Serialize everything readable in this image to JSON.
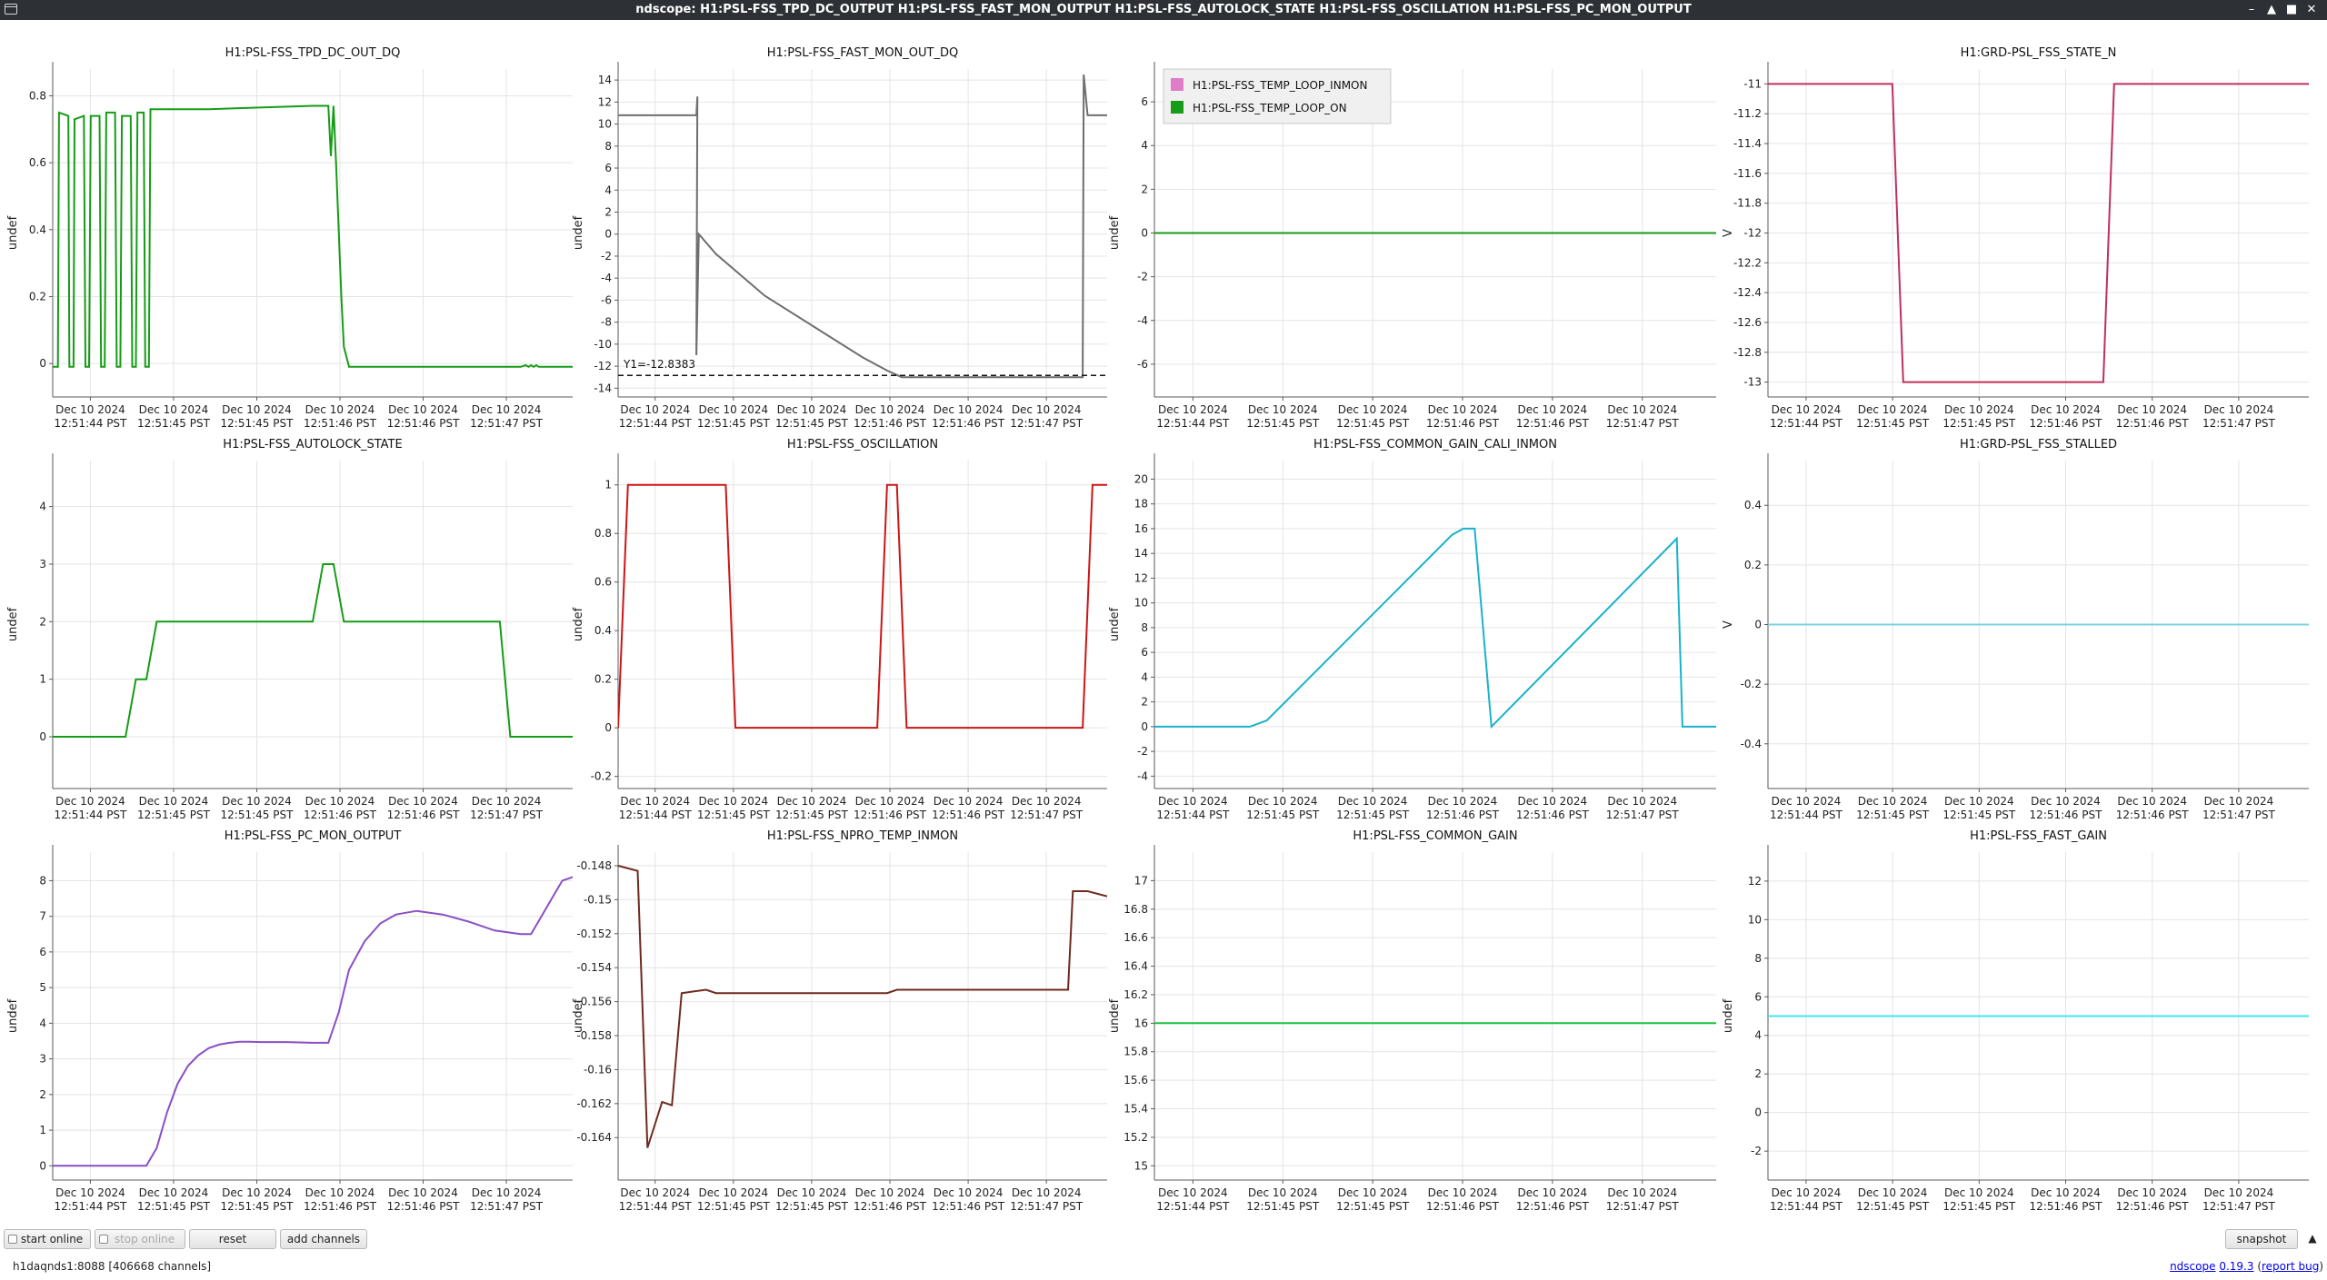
{
  "window": {
    "title": "ndscope: H1:PSL-FSS_TPD_DC_OUTPUT H1:PSL-FSS_FAST_MON_OUTPUT H1:PSL-FSS_AUTOLOCK_STATE H1:PSL-FSS_OSCILLATION H1:PSL-FSS_PC_MON_OUTPUT",
    "controls": {
      "minimize": "–",
      "restore": "▲",
      "maximize": "■",
      "close": "✕"
    }
  },
  "toolbar": {
    "start_online": "start online",
    "stop_online": "stop online",
    "reset": "reset",
    "add_channels": "add channels",
    "snapshot": "snapshot",
    "collapse": "▲"
  },
  "status": {
    "server": "h1daqnds1:8088",
    "channels": "[406668 channels]"
  },
  "version": {
    "app_link": "ndscope",
    "version_link": "0.19.3",
    "open_paren": " (",
    "bug_link": "report bug",
    "close_paren": ")"
  },
  "colors": {
    "background": "#ffffff",
    "grid": "#e4e4e4",
    "axis": "#5a5a5a",
    "titlebar": "#2d3136",
    "green": "#169c16",
    "gray": "#6e6e6e",
    "crimson": "#c0305c",
    "red": "#cc1616",
    "cyan": "#19b2cc",
    "light_cyan": "#7fd0dc",
    "purple": "#8a4fc4",
    "brown": "#6e2a1e",
    "bright_green": "#1bc43b",
    "aqua": "#3fe8e8",
    "pink": "#e07cc8"
  },
  "time_ticks": [
    {
      "date": "Dec 10 2024",
      "time": "12:51:44 PST"
    },
    {
      "date": "Dec 10 2024",
      "time": "12:51:45 PST"
    },
    {
      "date": "Dec 10 2024",
      "time": "12:51:45 PST"
    },
    {
      "date": "Dec 10 2024",
      "time": "12:51:46 PST"
    },
    {
      "date": "Dec 10 2024",
      "time": "12:51:46 PST"
    },
    {
      "date": "Dec 10 2024",
      "time": "12:51:47 PST"
    }
  ],
  "chart_data": [
    {
      "type": "line",
      "title": "H1:PSL-FSS_TPD_DC_OUT_DQ",
      "ylabel": "undef",
      "ylim": [
        -0.1,
        0.88
      ],
      "yticks": [
        0,
        0.2,
        0.4,
        0.6,
        0.8
      ],
      "series": [
        {
          "color": "#169c16",
          "x": [
            0,
            0.01,
            0.012,
            0.03,
            0.032,
            0.04,
            0.042,
            0.06,
            0.063,
            0.07,
            0.073,
            0.09,
            0.093,
            0.1,
            0.103,
            0.12,
            0.123,
            0.13,
            0.133,
            0.15,
            0.153,
            0.16,
            0.163,
            0.175,
            0.178,
            0.185,
            0.188,
            0.3,
            0.5,
            0.52,
            0.53,
            0.535,
            0.54,
            0.545,
            0.55,
            0.555,
            0.56,
            0.57,
            0.58,
            0.6,
            0.62,
            0.8,
            0.9,
            0.91,
            0.915,
            0.92,
            0.925,
            0.93,
            0.935,
            1
          ],
          "y": [
            -0.01,
            -0.01,
            0.75,
            0.74,
            -0.01,
            -0.01,
            0.73,
            0.74,
            -0.01,
            -0.01,
            0.74,
            0.74,
            -0.01,
            -0.01,
            0.75,
            0.75,
            -0.01,
            -0.01,
            0.74,
            0.74,
            -0.01,
            -0.01,
            0.75,
            0.75,
            -0.01,
            -0.01,
            0.76,
            0.76,
            0.77,
            0.77,
            0.77,
            0.62,
            0.77,
            0.6,
            0.4,
            0.2,
            0.05,
            -0.01,
            -0.01,
            -0.01,
            -0.01,
            -0.01,
            -0.01,
            -0.005,
            -0.01,
            -0.005,
            -0.01,
            -0.005,
            -0.01,
            -0.01
          ]
        }
      ]
    },
    {
      "type": "line",
      "title": "H1:PSL-FSS_FAST_MON_OUT_DQ",
      "ylabel": "undef",
      "ylim": [
        -14.8,
        15
      ],
      "yticks": [
        -14,
        -12,
        -10,
        -8,
        -6,
        -4,
        -2,
        0,
        2,
        4,
        6,
        8,
        10,
        12,
        14
      ],
      "cursor": {
        "label": "Y1=-12.8383",
        "y": -12.8383
      },
      "series": [
        {
          "color": "#6e6e6e",
          "x": [
            0,
            0.16,
            0.162,
            0.16,
            0.165,
            0.2,
            0.3,
            0.4,
            0.5,
            0.55,
            0.58,
            0.6,
            0.95,
            0.952,
            0.96,
            1
          ],
          "y": [
            10.8,
            10.8,
            12.5,
            -11,
            0,
            -1.8,
            -5.6,
            -8.4,
            -11.2,
            -12.4,
            -13,
            -13,
            -13,
            14.5,
            10.8,
            10.8
          ]
        }
      ]
    },
    {
      "type": "line",
      "title": "",
      "ylabel": "undef",
      "ylim": [
        -7.5,
        7.5
      ],
      "yticks": [
        -6,
        -4,
        -2,
        0,
        2,
        4,
        6
      ],
      "legend": [
        {
          "label": "H1:PSL-FSS_TEMP_LOOP_INMON",
          "color": "#e07cc8"
        },
        {
          "label": "H1:PSL-FSS_TEMP_LOOP_ON",
          "color": "#169c16"
        }
      ],
      "series": [
        {
          "color": "#169c16",
          "x": [
            0,
            1
          ],
          "y": [
            0,
            0
          ]
        }
      ]
    },
    {
      "type": "line",
      "title": "H1:GRD-PSL_FSS_STATE_N",
      "ylabel": "V",
      "ylim": [
        -13.1,
        -10.9
      ],
      "yticks": [
        -13,
        -12.8,
        -12.6,
        -12.4,
        -12.2,
        -12,
        -11.8,
        -11.6,
        -11.4,
        -11.2,
        -11
      ],
      "series": [
        {
          "color": "#c0305c",
          "x": [
            0,
            0.23,
            0.25,
            0.62,
            0.64,
            1
          ],
          "y": [
            -11,
            -11,
            -13,
            -13,
            -11,
            -11
          ]
        }
      ]
    },
    {
      "type": "line",
      "title": "H1:PSL-FSS_AUTOLOCK_STATE",
      "ylabel": "undef",
      "ylim": [
        -0.9,
        4.8
      ],
      "yticks": [
        0,
        1,
        2,
        3,
        4
      ],
      "series": [
        {
          "color": "#169c16",
          "x": [
            0,
            0.14,
            0.16,
            0.18,
            0.2,
            0.5,
            0.52,
            0.54,
            0.56,
            0.86,
            0.88,
            1
          ],
          "y": [
            0,
            0,
            1,
            1,
            2,
            2,
            3,
            3,
            2,
            2,
            0,
            0
          ]
        }
      ]
    },
    {
      "type": "line",
      "title": "H1:PSL-FSS_OSCILLATION",
      "ylabel": "undef",
      "ylim": [
        -0.25,
        1.1
      ],
      "yticks": [
        -0.2,
        0,
        0.2,
        0.4,
        0.6,
        0.8,
        1
      ],
      "series": [
        {
          "color": "#cc1616",
          "x": [
            0,
            0.02,
            0.22,
            0.24,
            0.53,
            0.55,
            0.57,
            0.59,
            0.95,
            0.97,
            1
          ],
          "y": [
            0,
            1,
            1,
            0,
            0,
            1,
            1,
            0,
            0,
            1,
            1
          ]
        }
      ]
    },
    {
      "type": "line",
      "title": "H1:PSL-FSS_COMMON_GAIN_CALI_INMON",
      "ylabel": "undef",
      "ylim": [
        -5,
        21.5
      ],
      "yticks": [
        -4,
        -2,
        0,
        2,
        4,
        6,
        8,
        10,
        12,
        14,
        16,
        18,
        20
      ],
      "series": [
        {
          "color": "#19b2cc",
          "x": [
            0,
            0.17,
            0.2,
            0.53,
            0.55,
            0.57,
            0.6,
            0.93,
            0.94,
            1
          ],
          "y": [
            0,
            0,
            0.5,
            15.5,
            16,
            16,
            0,
            15.2,
            0,
            0
          ]
        }
      ]
    },
    {
      "type": "line",
      "title": "H1:GRD-PSL_FSS_STALLED",
      "ylabel": "V",
      "ylim": [
        -0.55,
        0.55
      ],
      "yticks": [
        -0.4,
        -0.2,
        0,
        0.2,
        0.4
      ],
      "series": [
        {
          "color": "#7fd0dc",
          "x": [
            0,
            1
          ],
          "y": [
            0,
            0
          ]
        }
      ]
    },
    {
      "type": "line",
      "title": "H1:PSL-FSS_PC_MON_OUTPUT",
      "ylabel": "undef",
      "ylim": [
        -0.4,
        8.8
      ],
      "yticks": [
        0,
        1,
        2,
        3,
        4,
        5,
        6,
        7,
        8
      ],
      "series": [
        {
          "color": "#8a4fc4",
          "x": [
            0,
            0.18,
            0.2,
            0.22,
            0.24,
            0.26,
            0.28,
            0.3,
            0.32,
            0.34,
            0.36,
            0.38,
            0.4,
            0.45,
            0.5,
            0.53,
            0.55,
            0.57,
            0.6,
            0.63,
            0.66,
            0.7,
            0.75,
            0.8,
            0.85,
            0.9,
            0.92,
            0.94,
            0.96,
            0.98,
            1
          ],
          "y": [
            0,
            0,
            0.5,
            1.5,
            2.3,
            2.8,
            3.1,
            3.3,
            3.4,
            3.45,
            3.48,
            3.48,
            3.47,
            3.47,
            3.45,
            3.45,
            4.3,
            5.5,
            6.3,
            6.8,
            7.05,
            7.15,
            7.05,
            6.85,
            6.6,
            6.5,
            6.5,
            7,
            7.5,
            8,
            8.1
          ]
        }
      ]
    },
    {
      "type": "line",
      "title": "H1:PSL-FSS_NPRO_TEMP_INMON",
      "ylabel": "undef",
      "ylim": [
        -0.1665,
        -0.1472
      ],
      "yticks": [
        -0.164,
        -0.162,
        -0.16,
        -0.158,
        -0.156,
        -0.154,
        -0.152,
        -0.15,
        -0.148
      ],
      "series": [
        {
          "color": "#6e2a1e",
          "x": [
            0,
            0.04,
            0.06,
            0.09,
            0.11,
            0.13,
            0.18,
            0.2,
            0.25,
            0.3,
            0.5,
            0.55,
            0.57,
            0.6,
            0.8,
            0.92,
            0.93,
            0.96,
            1
          ],
          "y": [
            -0.148,
            -0.1483,
            -0.1646,
            -0.1619,
            -0.1621,
            -0.1555,
            -0.1553,
            -0.1555,
            -0.1555,
            -0.1555,
            -0.1555,
            -0.1555,
            -0.1553,
            -0.1553,
            -0.1553,
            -0.1553,
            -0.1495,
            -0.1495,
            -0.1498
          ]
        }
      ]
    },
    {
      "type": "line",
      "title": "H1:PSL-FSS_COMMON_GAIN",
      "ylabel": "undef",
      "ylim": [
        14.9,
        17.2
      ],
      "yticks": [
        15,
        15.2,
        15.4,
        15.6,
        15.8,
        16,
        16.2,
        16.4,
        16.6,
        16.8,
        17
      ],
      "series": [
        {
          "color": "#1bc43b",
          "x": [
            0,
            1
          ],
          "y": [
            16,
            16
          ]
        }
      ]
    },
    {
      "type": "line",
      "title": "H1:PSL-FSS_FAST_GAIN",
      "ylabel": "undef",
      "ylim": [
        -3.5,
        13.5
      ],
      "yticks": [
        -2,
        0,
        2,
        4,
        6,
        8,
        10,
        12
      ],
      "series": [
        {
          "color": "#3fe8e8",
          "x": [
            0,
            1
          ],
          "y": [
            5,
            5
          ]
        }
      ]
    }
  ]
}
